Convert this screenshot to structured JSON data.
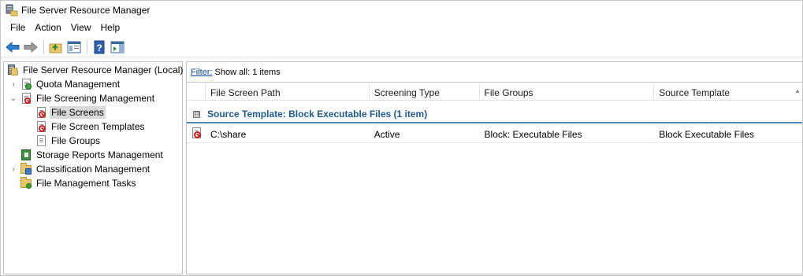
{
  "window": {
    "title": "File Server Resource Manager"
  },
  "menu": [
    "File",
    "Action",
    "View",
    "Help"
  ],
  "toolbar": {
    "buttons": [
      "back-icon",
      "forward-icon",
      "up-folder-icon",
      "show-hide-tree-icon",
      "help-icon",
      "action-pane-icon"
    ]
  },
  "tree": {
    "root": "File Server Resource Manager (Local)",
    "quota": "Quota Management",
    "screening": "File Screening Management",
    "file_screens": "File Screens",
    "templates": "File Screen Templates",
    "file_groups": "File Groups",
    "reports": "Storage Reports Management",
    "classification": "Classification Management",
    "tasks": "File Management Tasks"
  },
  "filter": {
    "link": "Filter:",
    "text": "Show all: 1 items"
  },
  "columns": [
    "File Screen Path",
    "Screening Type",
    "File Groups",
    "Source Template"
  ],
  "group": {
    "toggle": "⊟",
    "label": "Source Template: Block Executable Files (1 item)"
  },
  "rows": [
    {
      "path": "C:\\share",
      "type": "Active",
      "groups": "Block: Executable Files",
      "template": "Block Executable Files"
    }
  ],
  "colors": {
    "group_text": "#1e5a95",
    "group_line": "#4a8ab8",
    "link": "#0645ad",
    "selected_bg": "#d9d9d9"
  }
}
